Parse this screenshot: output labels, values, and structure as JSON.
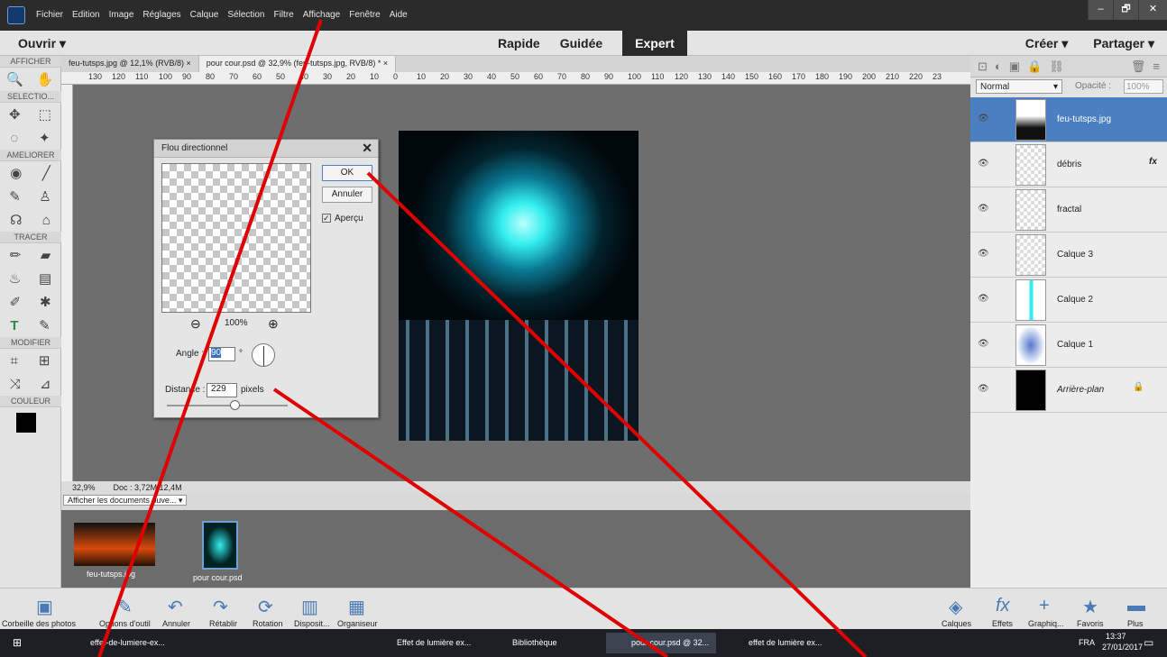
{
  "menubar": {
    "items": [
      "Fichier",
      "Edition",
      "Image",
      "Réglages",
      "Calque",
      "Sélection",
      "Filtre",
      "Affichage",
      "Fenêtre",
      "Aide"
    ],
    "min": "–",
    "max": "🗗",
    "close": "✕"
  },
  "modebar": {
    "open": "Ouvrir",
    "open_arrow": "▾",
    "modes": [
      "Rapide",
      "Guidée",
      "Expert"
    ],
    "create": "Créer ▾",
    "share": "Partager ▾"
  },
  "tools": {
    "sections": [
      "AFFICHER",
      "SELECTIO...",
      "AMELIORER",
      "TRACER",
      "MODIFIER",
      "COULEUR"
    ]
  },
  "tabs": [
    {
      "label": "feu-tutsps.jpg @ 12,1% (RVB/8)  ×"
    },
    {
      "label": "pour cour.psd @ 32,9% (feu-tutsps.jpg, RVB/8) *  ×"
    }
  ],
  "ruler": {
    "ticks": [
      "130",
      "120",
      "110",
      "100",
      "90",
      "80",
      "70",
      "60",
      "50",
      "40",
      "30",
      "20",
      "10",
      "0",
      "10",
      "20",
      "30",
      "40",
      "50",
      "60",
      "70",
      "80",
      "90",
      "100",
      "110",
      "120",
      "130",
      "140",
      "150",
      "160",
      "170",
      "180",
      "190",
      "200",
      "210",
      "220",
      "23"
    ]
  },
  "status": {
    "zoom": "32,9%",
    "doc": "Doc : 3,72M/12,4M"
  },
  "dialog": {
    "title": "Flou directionnel",
    "ok": "OK",
    "cancel": "Annuler",
    "preview_label": "Aperçu",
    "preview_checked": true,
    "zoom": "100%",
    "angle_label": "Angle :",
    "angle_value": "90",
    "angle_unit": "°",
    "distance_label": "Distance :",
    "distance_value": "229",
    "distance_unit": "pixels"
  },
  "layers_panel": {
    "blend": "Normal",
    "opacity_label": "Opacité :",
    "opacity": "100%",
    "layers": [
      {
        "name": "feu-tutsps.jpg",
        "selected": true,
        "fx": ""
      },
      {
        "name": "débris",
        "selected": false,
        "fx": "fx"
      },
      {
        "name": "fractal",
        "selected": false,
        "fx": ""
      },
      {
        "name": "Calque 3",
        "selected": false,
        "fx": ""
      },
      {
        "name": "Calque 2",
        "selected": false,
        "fx": ""
      },
      {
        "name": "Calque 1",
        "selected": false,
        "fx": ""
      },
      {
        "name": "Arrière-plan",
        "selected": false,
        "fx": ""
      }
    ]
  },
  "bin": {
    "dropdown": "Afficher les documents ouve... ▾",
    "items": [
      {
        "name": "feu-tutsps.jpg"
      },
      {
        "name": "pour cour.psd"
      }
    ]
  },
  "bottombar": {
    "left": [
      "Corbeille des photos",
      "Options d'outil",
      "Annuler",
      "Rétablir",
      "Rotation",
      "Disposit...",
      "Organiseur"
    ],
    "right": [
      "Calques",
      "Effets",
      "Graphiq...",
      "Favoris",
      "Plus"
    ]
  },
  "taskbar": {
    "items": [
      "effet-de-lumiere-ex...",
      "Effet de lumière ex...",
      "Bibliothèque",
      "pour cour.psd @ 32...",
      "effet de lumière ex..."
    ],
    "lang": "FRA",
    "time": "13:37",
    "date": "27/01/2017"
  },
  "colors": {
    "accent": "#4a7fc1",
    "annotation": "#e00000",
    "glow": "#3ee"
  }
}
